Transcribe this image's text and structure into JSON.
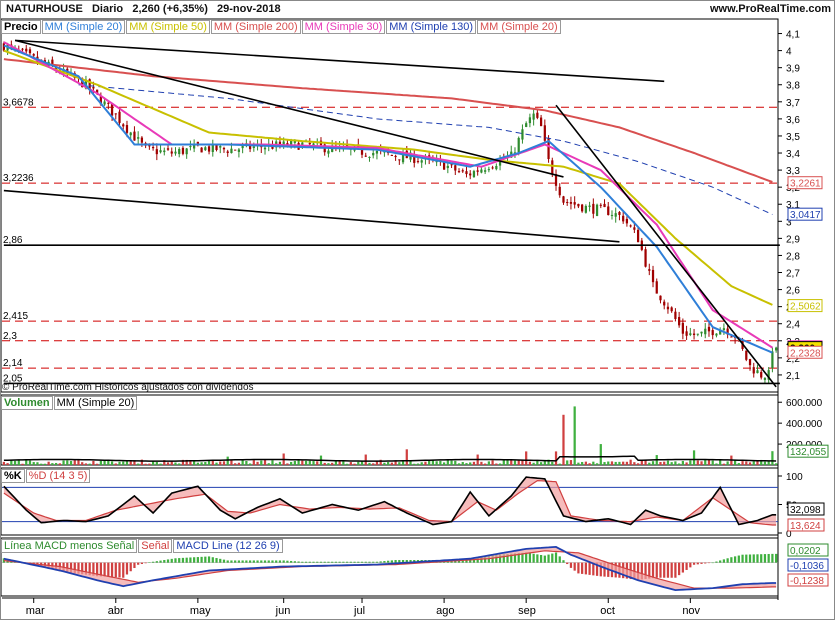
{
  "header": {
    "ticker": "NATURHOUSE",
    "period": "Diario",
    "change": "2,260 (+6,35%)",
    "date": "29-nov-2018",
    "site": "www.ProRealTime.com"
  },
  "copyright": "© ProRealTime.com  Históricos ajustados con dividendos",
  "colors": {
    "sma20": "#2f7fd8",
    "sma50": "#c8c000",
    "sma200": "#d85050",
    "sma30": "#e83ab8",
    "sma130": "#2040b0",
    "price_up": "#2e8b2e",
    "price_down": "#a00000",
    "support": "#d00000",
    "volume_up": "#3fb03f",
    "volume_down": "#d04040"
  },
  "price_panel": {
    "legend": {
      "title": "Precio",
      "sma20": "MM (Simple 20)",
      "sma50": "MM (Simple 50)",
      "sma200": "MM (Simple 200)",
      "sma30": "MM (Simple 30)",
      "sma130": "MM (Simple 130)",
      "sma20b": "MM (Simple 20)"
    },
    "level_labels": [
      {
        "text": "3,6678",
        "value": 3.6678
      },
      {
        "text": "3,2236",
        "value": 3.2236
      },
      {
        "text": "2,86",
        "value": 2.86
      },
      {
        "text": "2,415",
        "value": 2.415
      },
      {
        "text": "2,3",
        "value": 2.3
      },
      {
        "text": "2,14",
        "value": 2.14
      },
      {
        "text": "2,05",
        "value": 2.05
      }
    ],
    "right_badges": [
      {
        "text": "3,2261",
        "value": 3.2261,
        "color": "#d85050"
      },
      {
        "text": "3,0417",
        "value": 3.0417,
        "color": "#2040b0"
      },
      {
        "text": "2,5062",
        "value": 2.5062,
        "color": "#c8c000"
      },
      {
        "text": "2,2647",
        "value": 2.2647,
        "color": "#e83ab8"
      },
      {
        "text": "2,260",
        "value": 2.26,
        "color": "#000000"
      },
      {
        "text": "2,2328",
        "value": 2.2328,
        "color": "#d85050"
      }
    ]
  },
  "volume_panel": {
    "legend": {
      "title": "Volumen",
      "sma": "MM (Simple 20)"
    },
    "badge": "132,055"
  },
  "stoch_panel": {
    "legend": {
      "k": "%K",
      "d": "%D (14 3 5)"
    },
    "badges": [
      {
        "text": "32,098",
        "color": "#000000"
      },
      {
        "text": "13,624",
        "color": "#d04040"
      }
    ]
  },
  "macd_panel": {
    "legend": {
      "hist": "Línea MACD menos Señal",
      "signal": "Señal",
      "line": "MACD Line (12 26 9)"
    },
    "badges": [
      {
        "text": "0,0202",
        "color": "#2e8b2e"
      },
      {
        "text": "-0,1036",
        "color": "#2040b0"
      },
      {
        "text": "-0,1238",
        "color": "#d04040"
      }
    ]
  },
  "chart_data": [
    {
      "type": "candlestick",
      "title": "NATURHOUSE Diario",
      "ylim": [
        2.0,
        4.15
      ],
      "y_ticks": [
        "4,1",
        "4",
        "3,9",
        "3,8",
        "3,7",
        "3,6",
        "3,5",
        "3,4",
        "3,3",
        "3,2",
        "3,1",
        "3",
        "2,9",
        "2,8",
        "2,7",
        "2,6",
        "2,5",
        "2,4",
        "2,3",
        "2,2",
        "2,1"
      ],
      "x_ticks": [
        "mar",
        "abr",
        "may",
        "jun",
        "jul",
        "ago",
        "sep",
        "oct",
        "nov"
      ],
      "close_keypoints": [
        [
          0,
          4.03
        ],
        [
          8,
          3.95
        ],
        [
          15,
          3.88
        ],
        [
          22,
          3.8
        ],
        [
          30,
          3.62
        ],
        [
          38,
          3.42
        ],
        [
          45,
          3.4
        ],
        [
          52,
          3.43
        ],
        [
          60,
          3.42
        ],
        [
          70,
          3.44
        ],
        [
          80,
          3.45
        ],
        [
          90,
          3.42
        ],
        [
          100,
          3.4
        ],
        [
          110,
          3.37
        ],
        [
          118,
          3.33
        ],
        [
          124,
          3.27
        ],
        [
          130,
          3.33
        ],
        [
          136,
          3.38
        ],
        [
          140,
          3.57
        ],
        [
          142,
          3.62
        ],
        [
          144,
          3.55
        ],
        [
          146,
          3.35
        ],
        [
          150,
          3.12
        ],
        [
          156,
          3.08
        ],
        [
          162,
          3.06
        ],
        [
          166,
          3.02
        ],
        [
          170,
          2.9
        ],
        [
          174,
          2.62
        ],
        [
          178,
          2.5
        ],
        [
          182,
          2.35
        ],
        [
          186,
          2.33
        ],
        [
          190,
          2.36
        ],
        [
          193,
          2.38
        ],
        [
          196,
          2.33
        ],
        [
          200,
          2.15
        ],
        [
          203,
          2.1
        ],
        [
          205,
          2.1
        ],
        [
          206,
          2.26
        ]
      ],
      "sma_keypoints": {
        "sma20": [
          [
            0,
            4.03
          ],
          [
            20,
            3.85
          ],
          [
            35,
            3.45
          ],
          [
            60,
            3.45
          ],
          [
            100,
            3.42
          ],
          [
            125,
            3.32
          ],
          [
            138,
            3.4
          ],
          [
            146,
            3.47
          ],
          [
            160,
            3.2
          ],
          [
            175,
            2.85
          ],
          [
            190,
            2.38
          ],
          [
            206,
            2.23
          ]
        ],
        "sma30": [
          [
            0,
            4.05
          ],
          [
            25,
            3.75
          ],
          [
            45,
            3.45
          ],
          [
            70,
            3.45
          ],
          [
            100,
            3.43
          ],
          [
            128,
            3.32
          ],
          [
            145,
            3.45
          ],
          [
            160,
            3.3
          ],
          [
            175,
            2.98
          ],
          [
            190,
            2.48
          ],
          [
            206,
            2.26
          ]
        ],
        "sma50": [
          [
            0,
            4.0
          ],
          [
            25,
            3.8
          ],
          [
            55,
            3.52
          ],
          [
            80,
            3.47
          ],
          [
            110,
            3.42
          ],
          [
            130,
            3.36
          ],
          [
            150,
            3.32
          ],
          [
            165,
            3.22
          ],
          [
            180,
            2.9
          ],
          [
            195,
            2.62
          ],
          [
            206,
            2.51
          ]
        ],
        "sma130": [
          [
            20,
            3.8
          ],
          [
            60,
            3.72
          ],
          [
            100,
            3.6
          ],
          [
            130,
            3.55
          ],
          [
            150,
            3.47
          ],
          [
            170,
            3.35
          ],
          [
            190,
            3.2
          ],
          [
            206,
            3.04
          ]
        ],
        "sma200": [
          [
            0,
            3.95
          ],
          [
            40,
            3.85
          ],
          [
            80,
            3.78
          ],
          [
            120,
            3.72
          ],
          [
            145,
            3.65
          ],
          [
            165,
            3.55
          ],
          [
            185,
            3.4
          ],
          [
            206,
            3.23
          ]
        ]
      },
      "trendlines": [
        {
          "from": [
            3,
            4.06
          ],
          "to": [
            177,
            3.82
          ],
          "style": "solid"
        },
        {
          "from": [
            3,
            4.06
          ],
          "to": [
            150,
            3.26
          ],
          "style": "solid"
        },
        {
          "from": [
            0,
            3.18
          ],
          "to": [
            165,
            2.88
          ],
          "style": "solid"
        },
        {
          "from": [
            148,
            3.68
          ],
          "to": [
            207,
            2.03
          ],
          "style": "solid"
        },
        {
          "from": [
            0,
            2.86
          ],
          "to": [
            208,
            2.86
          ],
          "style": "solid"
        },
        {
          "from": [
            0,
            2.05
          ],
          "to": [
            208,
            2.05
          ],
          "style": "solid"
        }
      ],
      "support_lines": [
        3.6678,
        3.2236,
        2.415,
        2.3,
        2.14
      ]
    },
    {
      "type": "bar",
      "title": "Volumen",
      "y_ticks": [
        "600.000",
        "400.000",
        "200.000"
      ],
      "ylim": [
        0,
        650000
      ],
      "sma_level": 45000,
      "spikes": [
        [
          60,
          80000
        ],
        [
          75,
          110000
        ],
        [
          85,
          90000
        ],
        [
          97,
          100000
        ],
        [
          108,
          150000
        ],
        [
          127,
          100000
        ],
        [
          140,
          130000
        ],
        [
          148,
          130000
        ],
        [
          150,
          480000
        ],
        [
          153,
          560000
        ],
        [
          160,
          200000
        ],
        [
          175,
          95000
        ],
        [
          185,
          140000
        ],
        [
          195,
          90000
        ],
        [
          206,
          132055
        ]
      ]
    },
    {
      "type": "line",
      "title": "%K %D (14 3 5)",
      "y_ticks": [
        "100",
        "50",
        "0"
      ],
      "ylim": [
        0,
        100
      ],
      "overbought": 80,
      "oversold": 20,
      "k_keypoints": [
        [
          0,
          82
        ],
        [
          6,
          40
        ],
        [
          10,
          18
        ],
        [
          16,
          22
        ],
        [
          22,
          20
        ],
        [
          28,
          30
        ],
        [
          35,
          65
        ],
        [
          40,
          35
        ],
        [
          45,
          70
        ],
        [
          52,
          82
        ],
        [
          58,
          40
        ],
        [
          62,
          25
        ],
        [
          68,
          45
        ],
        [
          74,
          60
        ],
        [
          80,
          35
        ],
        [
          88,
          50
        ],
        [
          95,
          40
        ],
        [
          102,
          55
        ],
        [
          108,
          35
        ],
        [
          115,
          15
        ],
        [
          120,
          20
        ],
        [
          125,
          72
        ],
        [
          130,
          30
        ],
        [
          136,
          65
        ],
        [
          140,
          98
        ],
        [
          145,
          95
        ],
        [
          150,
          30
        ],
        [
          156,
          20
        ],
        [
          162,
          25
        ],
        [
          168,
          15
        ],
        [
          172,
          40
        ],
        [
          176,
          30
        ],
        [
          182,
          22
        ],
        [
          187,
          35
        ],
        [
          192,
          80
        ],
        [
          197,
          15
        ],
        [
          202,
          22
        ],
        [
          206,
          32
        ]
      ],
      "d_keypoints": [
        [
          0,
          70
        ],
        [
          8,
          35
        ],
        [
          14,
          22
        ],
        [
          22,
          22
        ],
        [
          30,
          40
        ],
        [
          38,
          50
        ],
        [
          46,
          60
        ],
        [
          54,
          68
        ],
        [
          60,
          38
        ],
        [
          66,
          35
        ],
        [
          74,
          50
        ],
        [
          82,
          42
        ],
        [
          90,
          45
        ],
        [
          98,
          42
        ],
        [
          106,
          44
        ],
        [
          114,
          22
        ],
        [
          120,
          20
        ],
        [
          127,
          55
        ],
        [
          132,
          40
        ],
        [
          138,
          70
        ],
        [
          143,
          92
        ],
        [
          148,
          90
        ],
        [
          152,
          30
        ],
        [
          160,
          22
        ],
        [
          168,
          20
        ],
        [
          175,
          28
        ],
        [
          182,
          22
        ],
        [
          190,
          62
        ],
        [
          195,
          40
        ],
        [
          200,
          18
        ],
        [
          206,
          14
        ]
      ]
    },
    {
      "type": "line",
      "title": "MACD Line (12 26 9)",
      "macd_keypoints": [
        [
          0,
          0.02
        ],
        [
          15,
          -0.04
        ],
        [
          25,
          -0.09
        ],
        [
          32,
          -0.12
        ],
        [
          40,
          -0.09
        ],
        [
          55,
          -0.04
        ],
        [
          75,
          -0.02
        ],
        [
          100,
          -0.01
        ],
        [
          125,
          0.02
        ],
        [
          140,
          0.07
        ],
        [
          148,
          0.08
        ],
        [
          152,
          0.04
        ],
        [
          160,
          -0.02
        ],
        [
          170,
          -0.09
        ],
        [
          180,
          -0.14
        ],
        [
          190,
          -0.13
        ],
        [
          198,
          -0.11
        ],
        [
          206,
          -0.1036
        ]
      ],
      "signal_keypoints": [
        [
          0,
          0.01
        ],
        [
          15,
          -0.02
        ],
        [
          28,
          -0.07
        ],
        [
          36,
          -0.1
        ],
        [
          46,
          -0.08
        ],
        [
          60,
          -0.04
        ],
        [
          80,
          -0.02
        ],
        [
          105,
          -0.01
        ],
        [
          130,
          0.02
        ],
        [
          145,
          0.06
        ],
        [
          154,
          0.05
        ],
        [
          165,
          -0.02
        ],
        [
          175,
          -0.08
        ],
        [
          185,
          -0.13
        ],
        [
          195,
          -0.13
        ],
        [
          206,
          -0.1238
        ]
      ]
    }
  ]
}
